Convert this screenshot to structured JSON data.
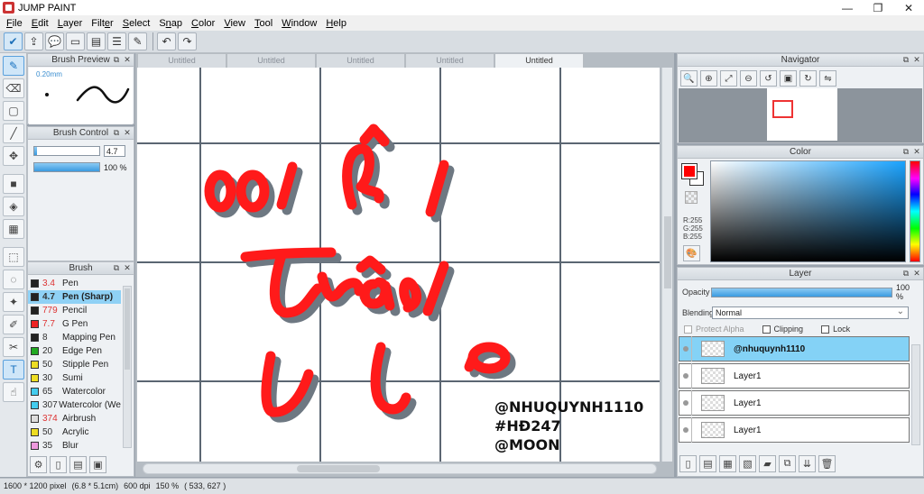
{
  "window": {
    "title": "JUMP PAINT",
    "minimize": "—",
    "maximize": "❐",
    "close": "✕"
  },
  "menu": [
    {
      "pre": "",
      "u": "F",
      "post": "ile"
    },
    {
      "pre": "",
      "u": "E",
      "post": "dit"
    },
    {
      "pre": "",
      "u": "L",
      "post": "ayer"
    },
    {
      "pre": "Filt",
      "u": "e",
      "post": "r"
    },
    {
      "pre": "",
      "u": "S",
      "post": "elect"
    },
    {
      "pre": "S",
      "u": "n",
      "post": "ap"
    },
    {
      "pre": "",
      "u": "C",
      "post": "olor"
    },
    {
      "pre": "",
      "u": "V",
      "post": "iew"
    },
    {
      "pre": "",
      "u": "T",
      "post": "ool"
    },
    {
      "pre": "",
      "u": "W",
      "post": "indow"
    },
    {
      "pre": "",
      "u": "H",
      "post": "elp"
    }
  ],
  "brush_preview": {
    "title": "Brush Preview",
    "size_label": "0.20mm"
  },
  "brush_control": {
    "title": "Brush Control",
    "size_value": "4.7",
    "opacity_value": "100 %",
    "size_fraction": 0.04,
    "opacity_fraction": 1.0
  },
  "brush_list": {
    "title": "Brush",
    "items": [
      {
        "size": "3.4",
        "name": "Pen",
        "color": "#222222",
        "size_red": true
      },
      {
        "size": "4.7",
        "name": "Pen (Sharp)",
        "color": "#222222",
        "size_red": false
      },
      {
        "size": "779",
        "name": "Pencil",
        "color": "#222222",
        "size_red": true
      },
      {
        "size": "7.7",
        "name": "G Pen",
        "color": "#ee2222",
        "size_red": true
      },
      {
        "size": "8",
        "name": "Mapping Pen",
        "color": "#222222",
        "size_red": false
      },
      {
        "size": "20",
        "name": "Edge Pen",
        "color": "#22aa22",
        "size_red": false
      },
      {
        "size": "50",
        "name": "Stipple Pen",
        "color": "#eedd22",
        "size_red": false
      },
      {
        "size": "30",
        "name": "Sumi",
        "color": "#eedd22",
        "size_red": false
      },
      {
        "size": "65",
        "name": "Watercolor",
        "color": "#44ccee",
        "size_red": false
      },
      {
        "size": "307",
        "name": "Watercolor (We",
        "color": "#44ccee",
        "size_red": false
      },
      {
        "size": "374",
        "name": "Airbrush",
        "color": "#dddddd",
        "size_red": true
      },
      {
        "size": "50",
        "name": "Acrylic",
        "color": "#eedd22",
        "size_red": false
      },
      {
        "size": "35",
        "name": "Blur",
        "color": "#ee99dd",
        "size_red": false
      }
    ]
  },
  "tabs": [
    "Untitled",
    "Untitled",
    "Untitled",
    "Untitled",
    "Untitled"
  ],
  "canvas": {
    "watermark_lines": [
      "@NHUQUYNH1110",
      "#HĐ247",
      "@MOON"
    ],
    "accent": "#ff1a1a",
    "shadow": "#6e7882"
  },
  "navigator": {
    "title": "Navigator"
  },
  "color": {
    "title": "Color",
    "r": "R:255",
    "g": "G:255",
    "b": "B:255",
    "fg": "#ff0000"
  },
  "layer": {
    "title": "Layer",
    "opacity_label": "Opacity",
    "opacity_value": "100 %",
    "blending_label": "Blending",
    "blending_value": "Normal",
    "protect_alpha": "Protect Alpha",
    "clipping": "Clipping",
    "lock": "Lock",
    "layers": [
      "@nhuquynh1110",
      "Layer1",
      "Layer1",
      "Layer1"
    ]
  },
  "status": {
    "size": "1600 * 1200 pixel",
    "physical": "(6.8 * 5.1cm)",
    "dpi": "600 dpi",
    "zoom": "150 %",
    "coords": "( 533, 627 )"
  }
}
